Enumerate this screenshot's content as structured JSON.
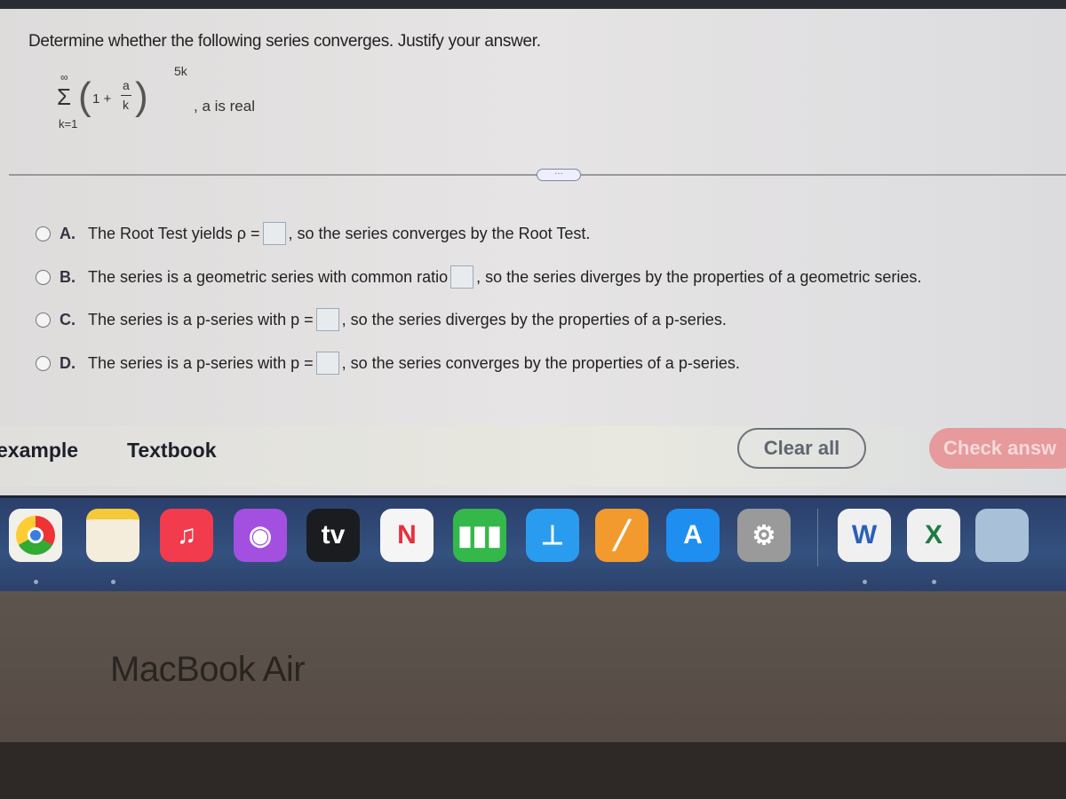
{
  "question": {
    "prompt": "Determine whether the following series converges. Justify your answer.",
    "formula": {
      "sum_upper": "∞",
      "sum_symbol": "Σ",
      "sum_lower": "k=1",
      "base": "1 +",
      "numerator": "a",
      "denominator": "k",
      "exponent": "5k",
      "condition": ", a is real"
    }
  },
  "more_button": "···",
  "options": [
    {
      "letter": "A.",
      "before": "The Root Test yields ρ =",
      "after": ", so the series converges by the Root Test."
    },
    {
      "letter": "B.",
      "before": "The series is a geometric series with common ratio",
      "after": ", so the series diverges by the properties of a geometric series."
    },
    {
      "letter": "C.",
      "before": "The series is a p-series with p =",
      "after": ", so the series diverges by the properties of a p-series."
    },
    {
      "letter": "D.",
      "before": "The series is a p-series with p =",
      "after": ", so the series converges by the properties of a p-series."
    }
  ],
  "footer": {
    "example": "example",
    "textbook": "Textbook",
    "clear_all": "Clear all",
    "check_answer": "Check answ"
  },
  "dock": [
    {
      "name": "chrome-icon",
      "label": "",
      "color": "#f2f0ea"
    },
    {
      "name": "notes-icon",
      "label": "",
      "color": "#f4eddc"
    },
    {
      "name": "music-icon",
      "label": "♫",
      "color": "#f23b4c"
    },
    {
      "name": "podcasts-icon",
      "label": "◉",
      "color": "#a34fe0"
    },
    {
      "name": "apple-tv-icon",
      "label": "tv",
      "color": "#1b1c20"
    },
    {
      "name": "news-icon",
      "label": "N",
      "color": "#f5f5f5"
    },
    {
      "name": "numbers-icon",
      "label": "▮▮▮",
      "color": "#35b84a"
    },
    {
      "name": "keynote-icon",
      "label": "⊥",
      "color": "#2a9cf0"
    },
    {
      "name": "pages-icon",
      "label": "╱",
      "color": "#f29a2e"
    },
    {
      "name": "app-store-icon",
      "label": "A",
      "color": "#1e8ff0"
    },
    {
      "name": "system-preferences-icon",
      "label": "⚙",
      "color": "#9a9a9a"
    },
    {
      "name": "word-icon",
      "label": "W",
      "color": "#f0f0f0"
    },
    {
      "name": "excel-icon",
      "label": "X",
      "color": "#f0f0f0"
    },
    {
      "name": "preview-icon",
      "label": "",
      "color": "#a8c0d8"
    }
  ],
  "device_label": "MacBook Air"
}
